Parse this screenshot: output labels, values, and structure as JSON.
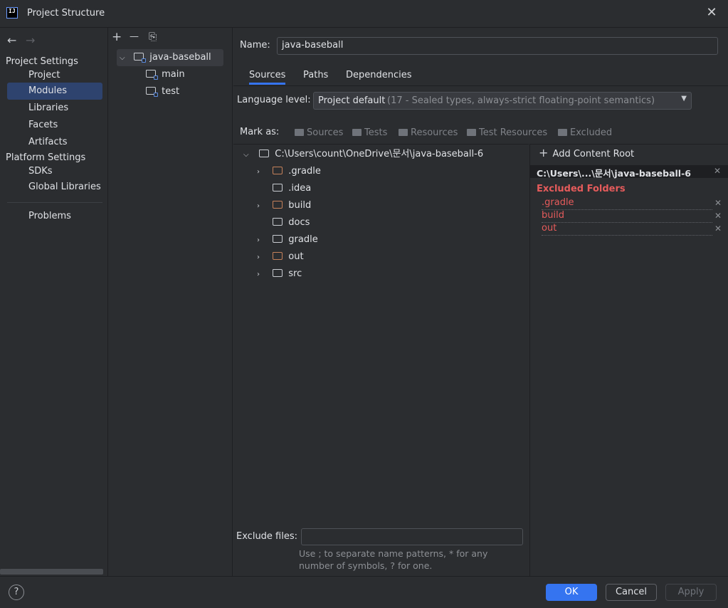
{
  "window": {
    "title": "Project Structure"
  },
  "nav": {
    "back_arrow": "←",
    "forward_arrow": "→",
    "project_settings": "Project Settings",
    "project_items": [
      "Project",
      "Modules",
      "Libraries",
      "Facets",
      "Artifacts"
    ],
    "platform_settings": "Platform Settings",
    "platform_items": [
      "SDKs",
      "Global Libraries"
    ],
    "problems": "Problems",
    "selected": "Modules"
  },
  "modules": {
    "toolbar": {
      "add": "+",
      "remove": "—",
      "copy": "⎘"
    },
    "root": "java-baseball",
    "children": [
      "main",
      "test"
    ]
  },
  "main": {
    "name_label": "Name:",
    "name_value": "java-baseball",
    "tabs": [
      "Sources",
      "Paths",
      "Dependencies"
    ],
    "selected_tab": "Sources",
    "language_label": "Language level:",
    "language_value": "Project default",
    "language_hint": "(17 - Sealed types, always-strict floating-point semantics)",
    "mark_as": "Mark as:",
    "mark_buttons": [
      "Sources",
      "Tests",
      "Resources",
      "Test Resources",
      "Excluded"
    ],
    "tree_root": "C:\\Users\\count\\OneDrive\\문서\\java-baseball-6",
    "tree_items": [
      ".gradle",
      ".idea",
      "build",
      "docs",
      "gradle",
      "out",
      "src"
    ],
    "exclude_label": "Exclude files:",
    "exclude_value": "",
    "exclude_hint_1": "Use ; to separate name patterns, * for any",
    "exclude_hint_2": "number of symbols, ? for one."
  },
  "content_root": {
    "add_label": "Add Content Root",
    "path": "C:\\Users\\...\\문서\\java-baseball-6",
    "excluded_title": "Excluded Folders",
    "excluded": [
      ".gradle",
      "build",
      "out"
    ]
  },
  "buttons": {
    "ok": "OK",
    "cancel": "Cancel",
    "apply": "Apply",
    "help": "?"
  },
  "colors": {
    "accent": "#3574f0",
    "selection": "#2e436e",
    "excluded": "#e55b5b",
    "folder_excluded": "#c5815a"
  }
}
